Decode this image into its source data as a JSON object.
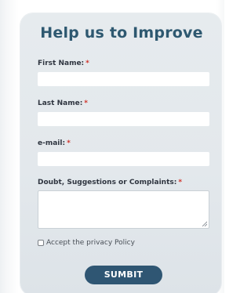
{
  "form": {
    "title": "Help us to Improve",
    "required_marker": "*",
    "fields": [
      {
        "label": "First Name:",
        "value": ""
      },
      {
        "label": "Last Name:",
        "value": ""
      },
      {
        "label": "e-mail:",
        "value": ""
      },
      {
        "label": "Doubt, Suggestions or Complaints:",
        "value": ""
      }
    ],
    "privacy_label": "Accept the privacy Policy",
    "privacy_checked": false,
    "submit_label": "SUMBIT"
  },
  "colors": {
    "title": "#2e5870",
    "required": "#d0342c",
    "button": "#2f5673",
    "card": "#e4e9ed"
  }
}
